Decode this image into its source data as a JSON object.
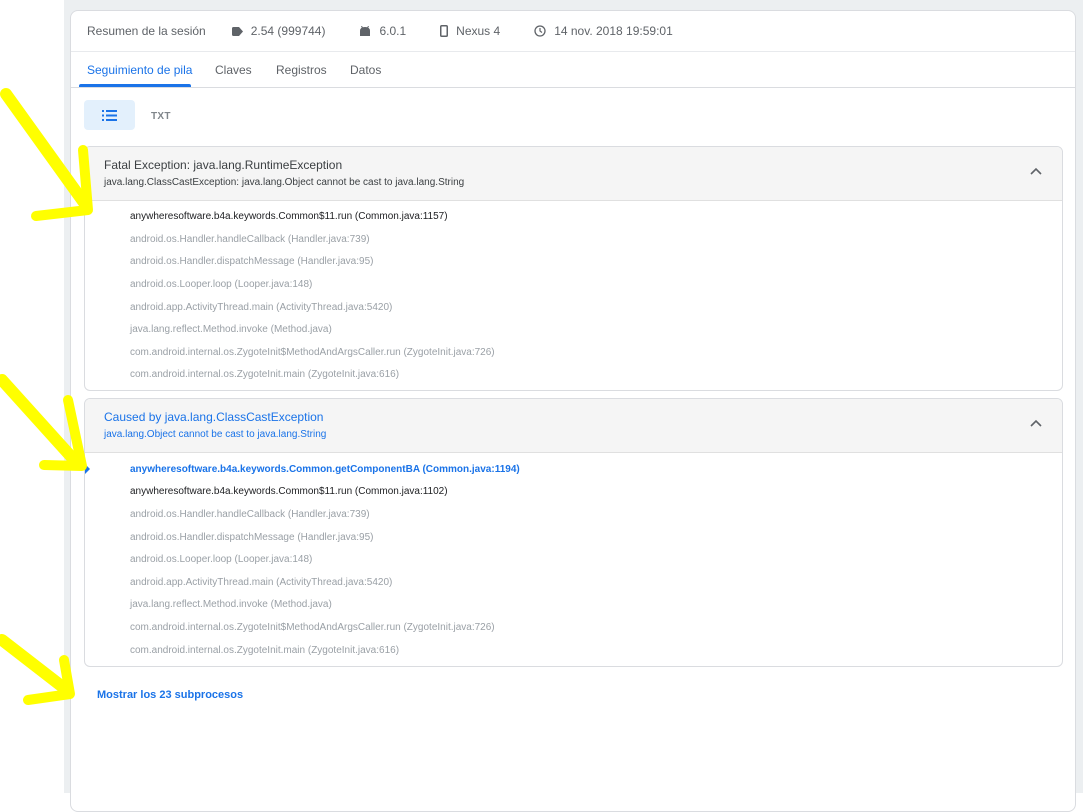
{
  "summary": {
    "label": "Resumen de la sesión",
    "version": "2.54 (999744)",
    "os": "6.0.1",
    "device": "Nexus 4",
    "datetime": "14 nov. 2018 19:59:01"
  },
  "tabs": [
    {
      "label": "Seguimiento de pila"
    },
    {
      "label": "Claves"
    },
    {
      "label": "Registros"
    },
    {
      "label": "Datos"
    }
  ],
  "view_toggle": {
    "txt_label": "TXT"
  },
  "exceptions": [
    {
      "title": "Fatal Exception: java.lang.RuntimeException",
      "subtitle": "java.lang.ClassCastException: java.lang.Object cannot be cast to java.lang.String",
      "frames": [
        "anywheresoftware.b4a.keywords.Common$11.run (Common.java:1157)",
        "android.os.Handler.handleCallback (Handler.java:739)",
        "android.os.Handler.dispatchMessage (Handler.java:95)",
        "android.os.Looper.loop (Looper.java:148)",
        "android.app.ActivityThread.main (ActivityThread.java:5420)",
        "java.lang.reflect.Method.invoke (Method.java)",
        "com.android.internal.os.ZygoteInit$MethodAndArgsCaller.run (ZygoteInit.java:726)",
        "com.android.internal.os.ZygoteInit.main (ZygoteInit.java:616)"
      ]
    },
    {
      "title": "Caused by java.lang.ClassCastException",
      "subtitle": "java.lang.Object cannot be cast to java.lang.String",
      "frames": [
        "anywheresoftware.b4a.keywords.Common.getComponentBA (Common.java:1194)",
        "anywheresoftware.b4a.keywords.Common$11.run (Common.java:1102)",
        "android.os.Handler.handleCallback (Handler.java:739)",
        "android.os.Handler.dispatchMessage (Handler.java:95)",
        "android.os.Looper.loop (Looper.java:148)",
        "android.app.ActivityThread.main (ActivityThread.java:5420)",
        "java.lang.reflect.Method.invoke (Method.java)",
        "com.android.internal.os.ZygoteInit$MethodAndArgsCaller.run (ZygoteInit.java:726)",
        "com.android.internal.os.ZygoteInit.main (ZygoteInit.java:616)"
      ]
    }
  ],
  "threads_link": "Mostrar los 23 subprocesos",
  "colors": {
    "accent": "#1a73e8",
    "annotation": "#ffff00"
  }
}
